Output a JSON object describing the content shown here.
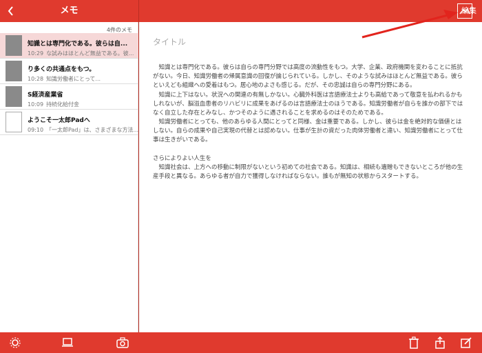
{
  "topbar": {
    "back_icon": "chevron-left-icon",
    "title": "メモ",
    "edit_label": "編集",
    "image_icon": "image-icon"
  },
  "sidebar": {
    "count_label": "4件のメモ",
    "items": [
      {
        "title": "知識とは専門化である。彼らは自...",
        "time": "10:29",
        "preview": "な試みはほとんど無益である。彼...",
        "thumb": "scan"
      },
      {
        "title": "り多くの共通点をもつ。",
        "time": "10:28",
        "preview": "知識労働者にとって...",
        "thumb": "scan"
      },
      {
        "title": "S経済産業省",
        "time": "10:09",
        "preview": "持続化給付金",
        "thumb": "scan"
      },
      {
        "title": "ようこそ一太郎Padへ",
        "time": "09:10",
        "preview": "「一太郎Pad」は、さまざまな方法...",
        "thumb": "doc"
      }
    ]
  },
  "bottombar": {
    "settings_icon": "gear-icon",
    "cast_icon": "tablet-icon",
    "camera_icon": "camera-icon",
    "trash_icon": "trash-icon",
    "share_icon": "share-icon",
    "compose_icon": "compose-icon"
  },
  "main": {
    "title_placeholder": "タイトル",
    "body": "　知識とは専門化である。彼らは自らの専門分野では高度の流動性をもつ。大学、企業、政府機関を変わることに抵抗がない。今日、知識労働者の帰属意識の回復が論じられている。しかし、そのような試みはほとんど無益である。彼らといえども組織への愛着はもつ。居心地のよさも感じる。だが、その忠誠は自らの専門分野にある。\n　知識に上下はない。状況への関連の有無しかない。心臓外科医は言語療法士よりも高給であって敬意を払われるかもしれないが、脳溢血患者のリハビリに成果をあげるのは言語療法士のほうである。知識労働者が自らを誰かの部下ではなく自立した存在とみなし、かつそのように遇されることを求めるのはそのためである。\n　知識労働者にとっても、他のあらゆる人間にとってと同様、金は重要である。しかし、彼らは金を絶対的な価値とはしない。自らの成果や自己実現の代替とは認めない。仕事が生計の資だった肉体労働者と違い、知識労働者にとって仕事は生きがいである。\n\nさらによりよい人生を\n　知識社会は、上方への移動に制限がないという初めての社会である。知識は、相続も遺贈もできないところが他の生産手段と異なる。あらゆる者が自力で獲得しなければならない。誰もが無知の状態からスタートする。"
  },
  "colors": {
    "accent": "#e03a2e",
    "selected": "#f6d8d8"
  }
}
